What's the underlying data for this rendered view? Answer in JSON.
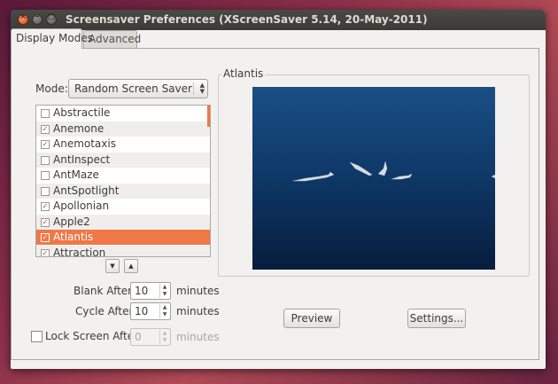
{
  "window": {
    "title": "Screensaver Preferences  (XScreenSaver 5.14, 20-May-2011)"
  },
  "tabs": [
    {
      "label": "Display Modes"
    },
    {
      "label": "Advanced"
    }
  ],
  "mode": {
    "label": "Mode:",
    "value": "Random Screen Saver"
  },
  "savers": [
    {
      "name": "Abstractile",
      "checked": false
    },
    {
      "name": "Anemone",
      "checked": true
    },
    {
      "name": "Anemotaxis",
      "checked": true
    },
    {
      "name": "AntInspect",
      "checked": false
    },
    {
      "name": "AntMaze",
      "checked": false
    },
    {
      "name": "AntSpotlight",
      "checked": false
    },
    {
      "name": "Apollonian",
      "checked": true
    },
    {
      "name": "Apple2",
      "checked": true
    },
    {
      "name": "Atlantis",
      "checked": true,
      "selected": true
    },
    {
      "name": "Attraction",
      "checked": true
    }
  ],
  "blank_after": {
    "label": "Blank After",
    "value": "10",
    "unit": "minutes"
  },
  "cycle_after": {
    "label": "Cycle After",
    "value": "10",
    "unit": "minutes"
  },
  "lock_screen": {
    "label": "Lock Screen After",
    "value": "0",
    "unit": "minutes",
    "checked": false
  },
  "preview_frame": {
    "title": "Atlantis"
  },
  "buttons": {
    "preview": "Preview",
    "settings": "Settings..."
  },
  "colors": {
    "accent": "#f07746",
    "titlebar": "#3c3b37",
    "preview_top": "#1a4f84",
    "preview_bottom": "#071d3d"
  }
}
